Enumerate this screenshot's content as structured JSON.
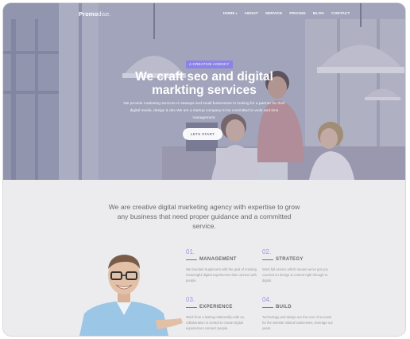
{
  "nav": {
    "logo_bold": "Promo",
    "logo_light": "dise.",
    "links": [
      "HOME",
      "ABOUT",
      "SERVICE",
      "PRICING",
      "BLOG",
      "CONTACT"
    ],
    "home_caret": "▾"
  },
  "hero": {
    "badge": "A CREATIVE AGENCY",
    "title": "We craft seo and digital markting services",
    "description": "We provide marketing services to startups and small businesses to looking for a partner for their digital media, design & dev We are a startup company to be committed to work and time management.",
    "cta_label": "LETS START"
  },
  "intro": {
    "text": "We are creative digital marketing agency with expertise to grow any business that need proper guidance and a committed service."
  },
  "features": [
    {
      "number": "01.",
      "title": "MANAGEMENT",
      "text": "We founded Suplement with the goal of creating meaningful digital experiences that connect with people."
    },
    {
      "number": "02.",
      "title": "STRATEGY",
      "text": "Work full service which means we've got you covered on design & content right through to digital."
    },
    {
      "number": "03.",
      "title": "EXPERIENCE",
      "text": "Work from a lasting relationship with us, collaboration is central to create Digital experiences connect people."
    },
    {
      "number": "04.",
      "title": "BUILD",
      "text": "Technology and design are the core of success for the website related businesses, leverage our years."
    }
  ]
}
